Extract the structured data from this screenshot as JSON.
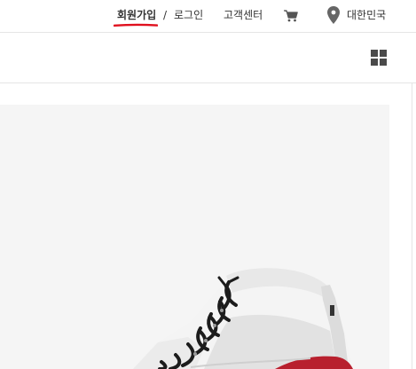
{
  "header": {
    "signup_label": "회원가입",
    "separator": "/",
    "login_label": "로그인",
    "help_label": "고객센터",
    "country_label": "대한민국",
    "accent_color": "#e0101e"
  },
  "icons": {
    "cart": "cart-icon",
    "location": "location-pin-icon",
    "grid": "grid-view-icon"
  },
  "product": {
    "image": "high-top-sneaker"
  }
}
